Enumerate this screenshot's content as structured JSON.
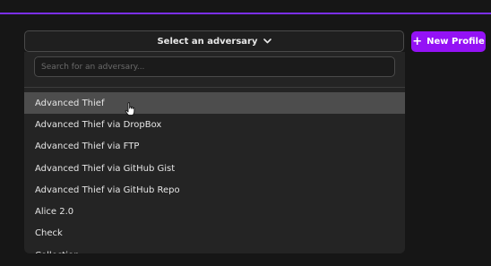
{
  "selector": {
    "label": "Select an adversary",
    "chevron_icon": "chevron-down-icon"
  },
  "new_profile_button": {
    "label": "New Profile",
    "icon": "plus-icon",
    "color": "#9412f5"
  },
  "accent_color": "#7b2ff0",
  "dropdown": {
    "search_placeholder": "Search for an adversary...",
    "options": [
      {
        "label": "Advanced Thief",
        "active": true
      },
      {
        "label": "Advanced Thief via DropBox",
        "active": false
      },
      {
        "label": "Advanced Thief via FTP",
        "active": false
      },
      {
        "label": "Advanced Thief via GitHub Gist",
        "active": false
      },
      {
        "label": "Advanced Thief via GitHub Repo",
        "active": false
      },
      {
        "label": "Alice 2.0",
        "active": false
      },
      {
        "label": "Check",
        "active": false
      },
      {
        "label": "Collection",
        "active": false
      }
    ]
  }
}
